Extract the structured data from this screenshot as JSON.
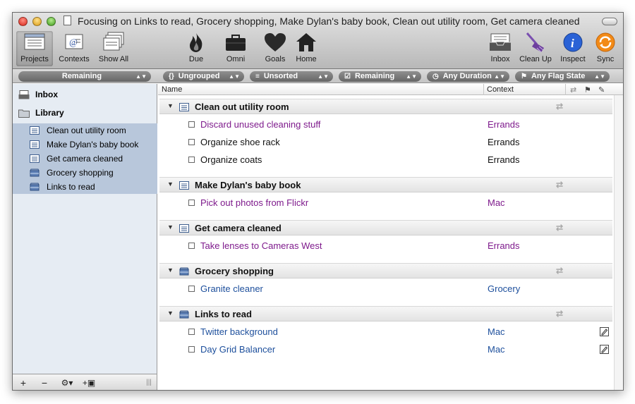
{
  "window": {
    "title": "Focusing on Links to read, Grocery shopping, Make Dylan's baby book, Clean out utility room, Get camera cleaned"
  },
  "toolbar": {
    "projects": "Projects",
    "contexts": "Contexts",
    "show_all": "Show All",
    "due": "Due",
    "omni": "Omni",
    "goals": "Goals",
    "home": "Home",
    "inbox": "Inbox",
    "clean_up": "Clean Up",
    "inspect": "Inspect",
    "sync": "Sync"
  },
  "filters": {
    "sidebar_filter": "Remaining",
    "grouping": "Ungrouped",
    "sorting": "Unsorted",
    "status": "Remaining",
    "duration": "Any Duration",
    "flag": "Any Flag State"
  },
  "sidebar": {
    "inbox": "Inbox",
    "library": "Library",
    "items": [
      {
        "label": "Clean out utility room",
        "icon": "project-icon"
      },
      {
        "label": "Make Dylan's baby book",
        "icon": "project-icon"
      },
      {
        "label": "Get camera cleaned",
        "icon": "project-icon"
      },
      {
        "label": "Grocery shopping",
        "icon": "single-action-list-icon"
      },
      {
        "label": "Links to read",
        "icon": "single-action-list-icon"
      }
    ]
  },
  "columns": {
    "name": "Name",
    "context": "Context"
  },
  "groups": [
    {
      "title": "Clean out utility room",
      "tasks": [
        {
          "name": "Discard unused cleaning stuff",
          "context": "Errands",
          "color": "purple"
        },
        {
          "name": "Organize shoe rack",
          "context": "Errands",
          "color": "black"
        },
        {
          "name": "Organize coats",
          "context": "Errands",
          "color": "black"
        }
      ]
    },
    {
      "title": "Make Dylan's baby book",
      "tasks": [
        {
          "name": "Pick out photos from Flickr",
          "context": "Mac",
          "color": "purple"
        }
      ]
    },
    {
      "title": "Get camera cleaned",
      "tasks": [
        {
          "name": "Take lenses to Cameras West",
          "context": "Errands",
          "color": "purple"
        }
      ]
    },
    {
      "title": "Grocery shopping",
      "tasks": [
        {
          "name": "Granite cleaner",
          "context": "Grocery",
          "color": "blue"
        }
      ]
    },
    {
      "title": "Links to read",
      "tasks": [
        {
          "name": "Twitter background",
          "context": "Mac",
          "color": "blue"
        },
        {
          "name": "Day Grid Balancer",
          "context": "Mac",
          "color": "blue"
        }
      ]
    }
  ],
  "colors": {
    "purple_text": "#7e1a8c",
    "blue_text": "#1d4f9c",
    "sidebar_selection": "#b8c7db",
    "sync_orange": "#f28a17",
    "inspect_blue": "#2a62d6"
  }
}
